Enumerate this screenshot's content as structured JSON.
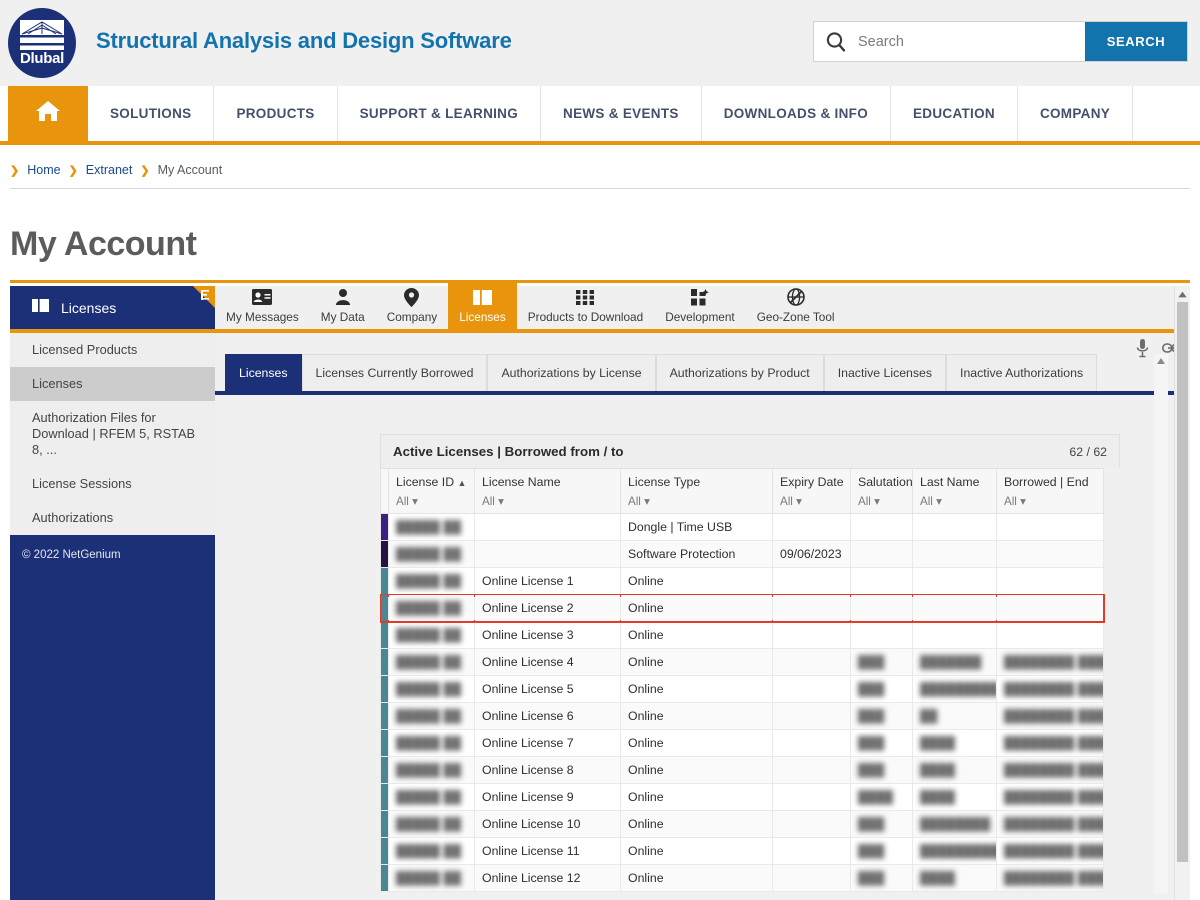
{
  "header": {
    "logo_word": "Dlubal",
    "brand_title": "Structural Analysis and Design Software",
    "search": {
      "placeholder": "Search",
      "value": "",
      "button_label": "SEARCH",
      "icon": "search-icon"
    }
  },
  "mainnav": {
    "home_icon": "home-icon",
    "items": [
      {
        "label": "SOLUTIONS"
      },
      {
        "label": "PRODUCTS"
      },
      {
        "label": "SUPPORT & LEARNING"
      },
      {
        "label": "NEWS & EVENTS"
      },
      {
        "label": "DOWNLOADS & INFO"
      },
      {
        "label": "EDUCATION"
      },
      {
        "label": "COMPANY"
      }
    ]
  },
  "breadcrumb": {
    "items": [
      {
        "label": "Home"
      },
      {
        "label": "Extranet"
      },
      {
        "label": "My Account"
      }
    ]
  },
  "page": {
    "title": "My Account"
  },
  "sidebar": {
    "header_label": "Licenses",
    "header_icon": "licenses-card-icon",
    "corner_icon": "list-corner-icon",
    "items": [
      {
        "label": "Licensed Products",
        "active": false
      },
      {
        "label": "Licenses",
        "active": true
      },
      {
        "label": "Authorization Files for Download | RFEM 5, RSTAB 8, ...",
        "active": false
      },
      {
        "label": "License Sessions",
        "active": false
      },
      {
        "label": "Authorizations",
        "active": false
      }
    ],
    "footer": "© 2022 NetGenium"
  },
  "icon_tabs": [
    {
      "label": "My Messages",
      "icon": "contact-card-icon",
      "active": false
    },
    {
      "label": "My Data",
      "icon": "person-icon",
      "active": false
    },
    {
      "label": "Company",
      "icon": "location-pin-icon",
      "active": false
    },
    {
      "label": "Licenses",
      "icon": "licenses-card-icon",
      "active": true
    },
    {
      "label": "Products to Download",
      "icon": "grid-icon",
      "active": false
    },
    {
      "label": "Development",
      "icon": "blocks-sparkle-icon",
      "active": false
    },
    {
      "label": "Geo-Zone Tool",
      "icon": "globe-icon",
      "active": false
    }
  ],
  "sub_tabs": [
    {
      "label": "Licenses",
      "active": true
    },
    {
      "label": "Licenses Currently Borrowed",
      "active": false
    },
    {
      "label": "Authorizations by License",
      "active": false
    },
    {
      "label": "Authorizations by Product",
      "active": false
    },
    {
      "label": "Inactive Licenses",
      "active": false
    },
    {
      "label": "Inactive Authorizations",
      "active": false
    }
  ],
  "tool_icons": [
    {
      "name": "microphone-icon"
    },
    {
      "name": "link-icon"
    }
  ],
  "table": {
    "title": "Active Licenses | Borrowed from / to",
    "count": "62 / 62",
    "columns": [
      {
        "label": "License ID",
        "filter": "All",
        "sorted": "asc"
      },
      {
        "label": "License Name",
        "filter": "All"
      },
      {
        "label": "License Type",
        "filter": "All"
      },
      {
        "label": "Expiry Date",
        "filter": "All"
      },
      {
        "label": "Salutation",
        "filter": "All"
      },
      {
        "label": "Last Name",
        "filter": "All"
      },
      {
        "label": "Borrowed | End",
        "filter": "All"
      }
    ],
    "rows": [
      {
        "stripe": "#3b2180",
        "license_id": "█████ ██",
        "license_id_redacted": true,
        "license_name": "",
        "license_type": "Dongle | Time USB",
        "expiry_date": "",
        "salutation": "",
        "last_name": "",
        "borrowed_end": "",
        "highlighted": false
      },
      {
        "stripe": "#231345",
        "license_id": "█████ ██",
        "license_id_redacted": true,
        "license_name": "",
        "license_type": "Software Protection",
        "expiry_date": "09/06/2023",
        "salutation": "",
        "last_name": "",
        "borrowed_end": "",
        "highlighted": false
      },
      {
        "stripe": "#4a8793",
        "license_id": "█████ ██",
        "license_id_redacted": true,
        "license_name": "Online License 1",
        "license_type": "Online",
        "expiry_date": "",
        "salutation": "",
        "last_name": "",
        "borrowed_end": "",
        "highlighted": false
      },
      {
        "stripe": "#4a8793",
        "license_id": "█████ ██",
        "license_id_redacted": true,
        "license_name": "Online License 2",
        "license_type": "Online",
        "expiry_date": "",
        "salutation": "",
        "last_name": "",
        "borrowed_end": "",
        "highlighted": true
      },
      {
        "stripe": "#4a8793",
        "license_id": "█████ ██",
        "license_id_redacted": true,
        "license_name": "Online License 3",
        "license_type": "Online",
        "expiry_date": "",
        "salutation": "",
        "last_name": "",
        "borrowed_end": "",
        "highlighted": false
      },
      {
        "stripe": "#4a8793",
        "license_id": "█████ ██",
        "license_id_redacted": true,
        "license_name": "Online License 4",
        "license_type": "Online",
        "expiry_date": "",
        "salutation": "███",
        "last_name": "███████",
        "borrowed_end": "████████ ████",
        "highlighted": false
      },
      {
        "stripe": "#4a8793",
        "license_id": "█████ ██",
        "license_id_redacted": true,
        "license_name": "Online License 5",
        "license_type": "Online",
        "expiry_date": "",
        "salutation": "███",
        "last_name": "█████████",
        "borrowed_end": "████████ ████",
        "highlighted": false
      },
      {
        "stripe": "#4a8793",
        "license_id": "█████ ██",
        "license_id_redacted": true,
        "license_name": "Online License 6",
        "license_type": "Online",
        "expiry_date": "",
        "salutation": "███",
        "last_name": "██",
        "borrowed_end": "████████ ████",
        "highlighted": false
      },
      {
        "stripe": "#4a8793",
        "license_id": "█████ ██",
        "license_id_redacted": true,
        "license_name": "Online License 7",
        "license_type": "Online",
        "expiry_date": "",
        "salutation": "███",
        "last_name": "████",
        "borrowed_end": "████████ ████",
        "highlighted": false
      },
      {
        "stripe": "#4a8793",
        "license_id": "█████ ██",
        "license_id_redacted": true,
        "license_name": "Online License 8",
        "license_type": "Online",
        "expiry_date": "",
        "salutation": "███",
        "last_name": "████",
        "borrowed_end": "████████ ████",
        "highlighted": false
      },
      {
        "stripe": "#4a8793",
        "license_id": "█████ ██",
        "license_id_redacted": true,
        "license_name": "Online License 9",
        "license_type": "Online",
        "expiry_date": "",
        "salutation": "████",
        "last_name": "████",
        "borrowed_end": "████████ ████",
        "highlighted": false
      },
      {
        "stripe": "#4a8793",
        "license_id": "█████ ██",
        "license_id_redacted": true,
        "license_name": "Online License 10",
        "license_type": "Online",
        "expiry_date": "",
        "salutation": "███",
        "last_name": "████████",
        "borrowed_end": "████████ ████",
        "highlighted": false
      },
      {
        "stripe": "#4a8793",
        "license_id": "█████ ██",
        "license_id_redacted": true,
        "license_name": "Online License 11",
        "license_type": "Online",
        "expiry_date": "",
        "salutation": "███",
        "last_name": "██████████",
        "borrowed_end": "████████ ████",
        "highlighted": false
      },
      {
        "stripe": "#4a8793",
        "license_id": "█████ ██",
        "license_id_redacted": true,
        "license_name": "Online License 12",
        "license_type": "Online",
        "expiry_date": "",
        "salutation": "███",
        "last_name": "████",
        "borrowed_end": "████████ ████",
        "highlighted": false
      }
    ]
  },
  "colors": {
    "brand_navy": "#1c3078",
    "brand_orange": "#e8940c",
    "brand_blue": "#1273ad",
    "highlight_red": "#e03a28"
  }
}
